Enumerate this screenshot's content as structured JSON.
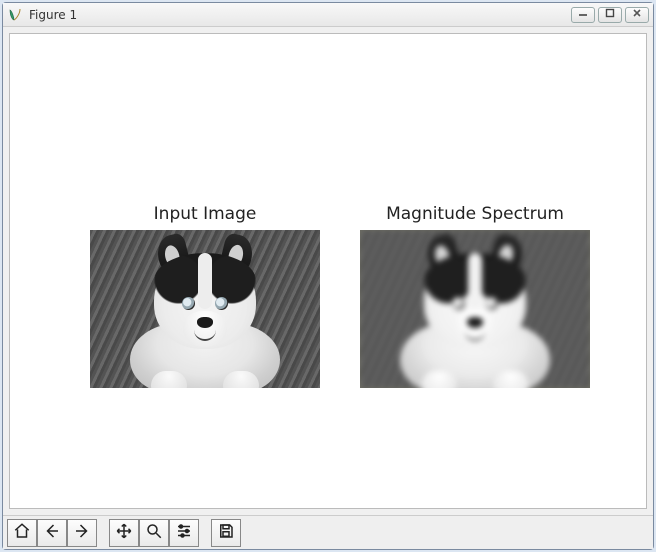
{
  "window": {
    "title": "Figure 1"
  },
  "subplots": {
    "left": {
      "title": "Input Image"
    },
    "right": {
      "title": "Magnitude Spectrum"
    }
  },
  "toolbar": {
    "home": "Home",
    "back": "Back",
    "forward": "Forward",
    "pan": "Pan",
    "zoom": "Zoom",
    "configure": "Configure subplots",
    "save": "Save"
  },
  "window_controls": {
    "minimize": "Minimize",
    "maximize": "Maximize",
    "close": "Close"
  }
}
